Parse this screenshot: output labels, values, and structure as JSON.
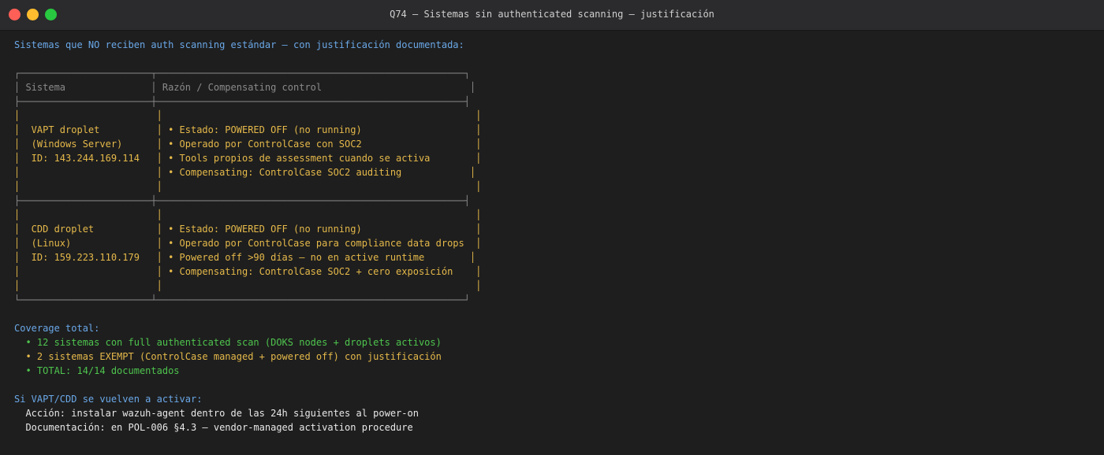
{
  "window": {
    "title": "Q74 — Sistemas sin authenticated scanning — justificación"
  },
  "colors": {
    "blue": "#6aa8e8",
    "yellow": "#e5b94a",
    "green": "#4ec44e",
    "white": "#e8e8e8",
    "border": "#8a8a8a"
  },
  "intro": "Sistemas que NO reciben auth scanning estándar — con justificación documentada:",
  "table": {
    "top": "┌───────────────────────┬──────────────────────────────────────────────────────┐",
    "header": "│ Sistema               │ Razón / Compensating control                          │",
    "header_sep": "├───────────────────────┼──────────────────────────────────────────────────────┤",
    "row_sep": "├───────────────────────┼──────────────────────────────────────────────────────┤",
    "bottom": "└───────────────────────┴──────────────────────────────────────────────────────┘",
    "rows": [
      {
        "lines": [
          "│                        │                                                       │",
          "│  VAPT droplet          │ • Estado: POWERED OFF (no running)                    │",
          "│  (Windows Server)      │ • Operado por ControlCase con SOC2                    │",
          "│  ID: 143.244.169.114   │ • Tools propios de assessment cuando se activa        │",
          "│                        │ • Compensating: ControlCase SOC2 auditing            │",
          "│                        │                                                       │"
        ]
      },
      {
        "lines": [
          "│                        │                                                       │",
          "│  CDD droplet           │ • Estado: POWERED OFF (no running)                    │",
          "│  (Linux)               │ • Operado por ControlCase para compliance data drops  │",
          "│  ID: 159.223.110.179   │ • Powered off >90 días — no en active runtime        │",
          "│                        │ • Compensating: ControlCase SOC2 + cero exposición    │",
          "│                        │                                                       │"
        ]
      }
    ]
  },
  "coverage": {
    "heading": "Coverage total:",
    "items": [
      "  • 12 sistemas con full authenticated scan (DOKS nodes + droplets activos)",
      "  • 2 sistemas EXEMPT (ControlCase managed + powered off) con justificación",
      "  • TOTAL: 14/14 documentados"
    ]
  },
  "reactivation": {
    "heading": "Si VAPT/CDD se vuelven a activar:",
    "lines": [
      "  Acción: instalar wazuh-agent dentro de las 24h siguientes al power-on",
      "  Documentación: en POL-006 §4.3 — vendor-managed activation procedure"
    ]
  }
}
